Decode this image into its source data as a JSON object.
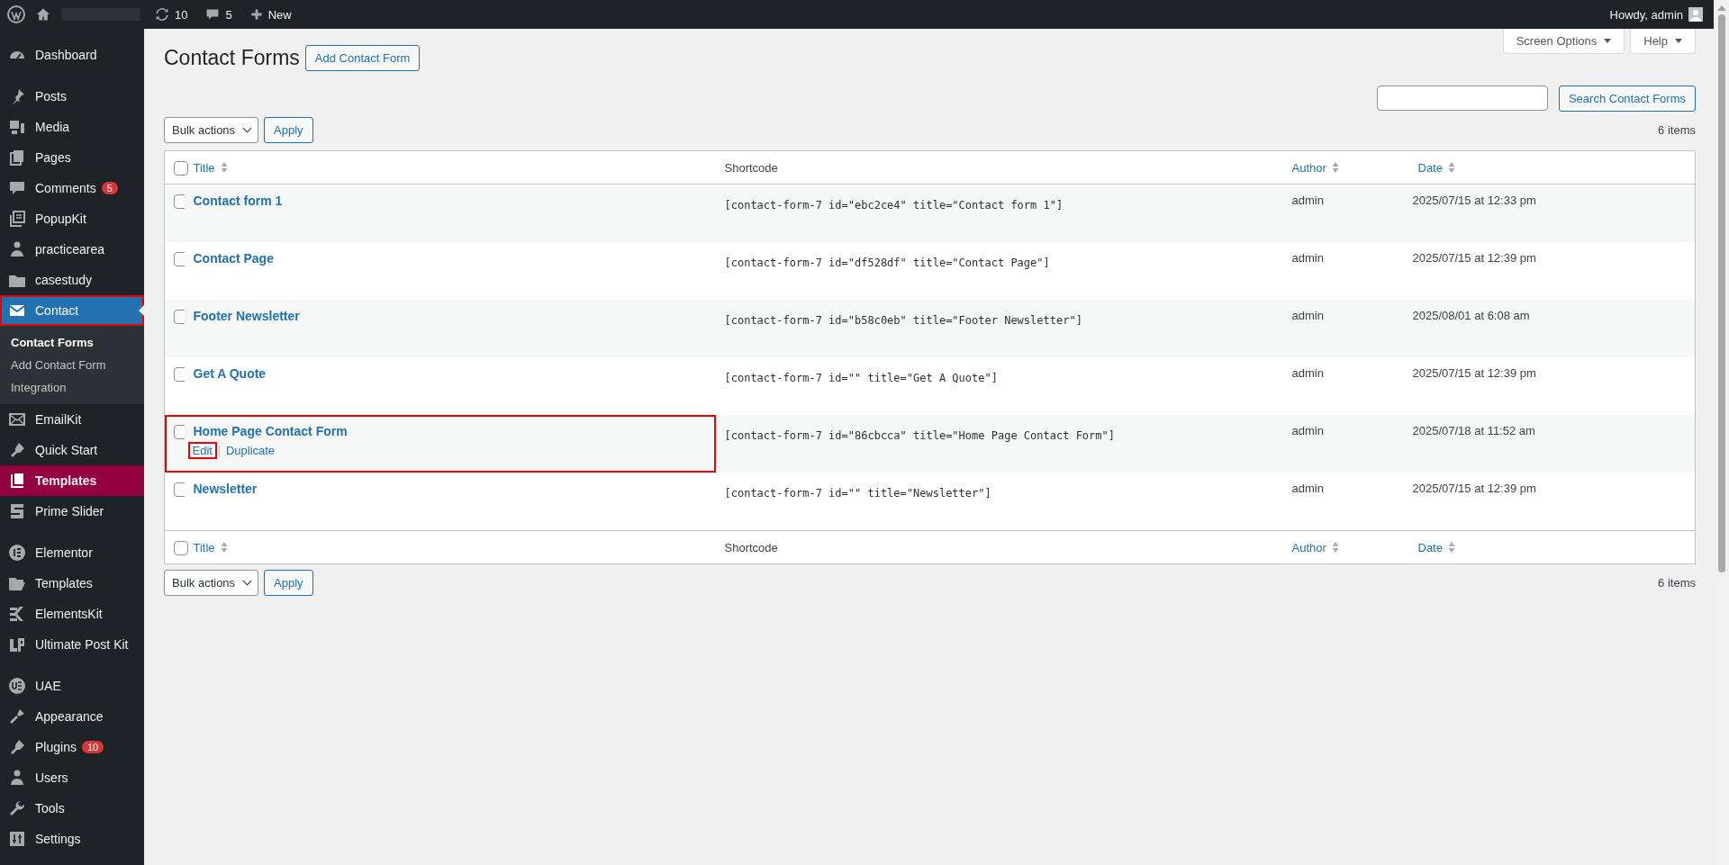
{
  "admin_bar": {
    "updates_count": "10",
    "comments_count": "5",
    "new_label": "New",
    "greeting": "Howdy, admin"
  },
  "sidebar": {
    "groups": [
      [
        {
          "label": "Dashboard",
          "selected": false,
          "marked": false
        }
      ],
      [
        {
          "label": "Posts",
          "selected": false,
          "marked": false
        },
        {
          "label": "Media",
          "selected": false,
          "marked": false
        },
        {
          "label": "Pages",
          "selected": false,
          "marked": false
        },
        {
          "label": "Comments",
          "badge": "5",
          "selected": false,
          "marked": false
        },
        {
          "label": "PopupKit",
          "selected": false,
          "marked": false
        },
        {
          "label": "practicearea",
          "selected": false,
          "marked": false
        },
        {
          "label": "casestudy",
          "selected": false,
          "marked": false
        },
        {
          "label": "Contact",
          "selected": true,
          "marked": true,
          "submenu": [
            {
              "label": "Contact Forms",
              "selected": true
            },
            {
              "label": "Add Contact Form",
              "selected": false
            },
            {
              "label": "Integration",
              "selected": false
            }
          ]
        },
        {
          "label": "EmailKit",
          "selected": false,
          "marked": false
        },
        {
          "label": "Quick Start",
          "selected": false,
          "marked": false
        },
        {
          "label": "Templates",
          "selected": false,
          "marked": false,
          "color": "#93003f"
        },
        {
          "label": "Prime Slider",
          "selected": false,
          "marked": false
        }
      ],
      [
        {
          "label": "Elementor",
          "selected": false,
          "marked": false
        },
        {
          "label": "Templates",
          "selected": false,
          "marked": false
        },
        {
          "label": "ElementsKit",
          "selected": false,
          "marked": false
        },
        {
          "label": "Ultimate Post Kit",
          "selected": false,
          "marked": false
        }
      ],
      [
        {
          "label": "UAE",
          "selected": false,
          "marked": false
        },
        {
          "label": "Appearance",
          "selected": false,
          "marked": false
        },
        {
          "label": "Plugins",
          "badge": "10",
          "selected": false,
          "marked": false
        },
        {
          "label": "Users",
          "selected": false,
          "marked": false
        },
        {
          "label": "Tools",
          "selected": false,
          "marked": false
        },
        {
          "label": "Settings",
          "selected": false,
          "marked": false
        }
      ]
    ]
  },
  "screen_tabs": [
    {
      "label": "Screen Options"
    },
    {
      "label": "Help"
    }
  ],
  "page": {
    "title": "Contact Forms",
    "add_button": "Add Contact Form",
    "search_button": "Search Contact Forms"
  },
  "top_nav": {
    "bulk_actions": "Bulk actions",
    "apply": "Apply",
    "count": "6 items"
  },
  "table": {
    "header_checkbox": {
      "checked": false
    },
    "columns": [
      {
        "label": "Title",
        "sortable": true
      },
      {
        "label": "Shortcode",
        "sortable": false
      },
      {
        "label": "Author",
        "sortable": true
      },
      {
        "label": "Date",
        "sortable": true
      }
    ],
    "rows": [
      {
        "checked": false,
        "marked": false,
        "title": "Contact form 1",
        "shortcode": "[contact-form-7 id=\"ebc2ce4\" title=\"Contact form 1\"]",
        "author": "admin",
        "date": "2025/07/15 at 12:33 pm"
      },
      {
        "checked": false,
        "marked": false,
        "title": "Contact Page",
        "shortcode": "[contact-form-7 id=\"df528df\" title=\"Contact Page\"]",
        "author": "admin",
        "date": "2025/07/15 at 12:39 pm"
      },
      {
        "checked": false,
        "marked": false,
        "title": "Footer Newsletter",
        "shortcode": "[contact-form-7 id=\"b58c0eb\" title=\"Footer Newsletter\"]",
        "author": "admin",
        "date": "2025/08/01 at 6:08 am"
      },
      {
        "checked": false,
        "marked": false,
        "title": "Get A Quote",
        "shortcode": "[contact-form-7 id=\"\" title=\"Get A Quote\"]",
        "author": "admin",
        "date": "2025/07/15 at 12:39 pm"
      },
      {
        "checked": false,
        "marked": true,
        "title": "Home Page Contact Form",
        "shortcode": "[contact-form-7 id=\"86cbcca\" title=\"Home Page Contact Form\"]",
        "author": "admin",
        "date": "2025/07/18 at 11:52 am",
        "actions": [
          {
            "label": "Edit",
            "marked": true
          },
          {
            "label": "Duplicate",
            "marked": false
          }
        ]
      },
      {
        "checked": false,
        "marked": false,
        "title": "Newsletter",
        "shortcode": "[contact-form-7 id=\"\" title=\"Newsletter\"]",
        "author": "admin",
        "date": "2025/07/15 at 12:39 pm"
      }
    ],
    "footer_checkbox": {
      "checked": false
    },
    "footer_columns": [
      {
        "label": "Title",
        "sortable": true
      },
      {
        "label": "Shortcode",
        "sortable": false
      },
      {
        "label": "Author",
        "sortable": true
      },
      {
        "label": "Date",
        "sortable": true
      }
    ]
  },
  "bottom_nav": {
    "bulk_actions": "Bulk actions",
    "apply": "Apply",
    "count": "6 items"
  }
}
